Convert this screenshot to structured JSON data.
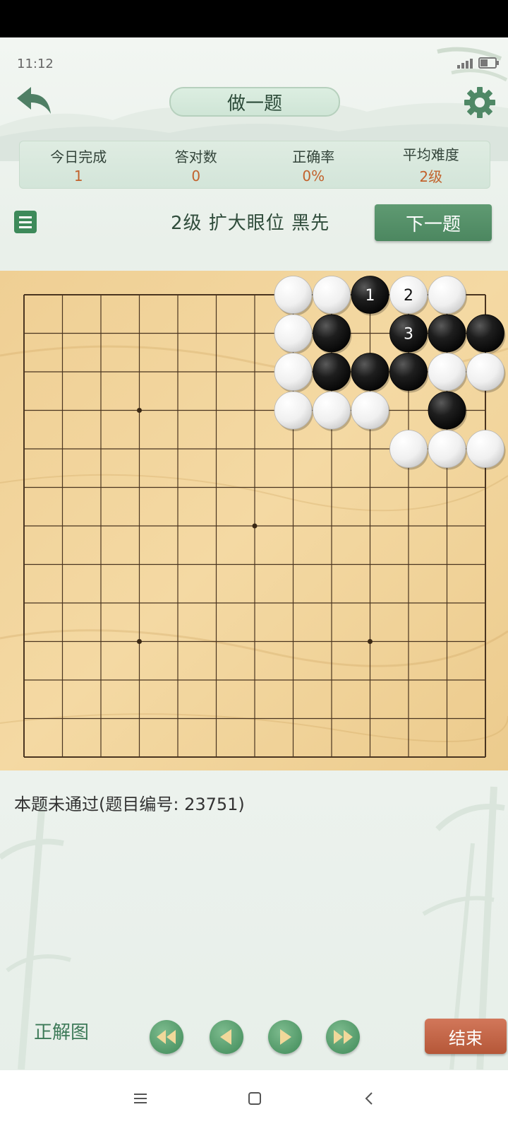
{
  "status_bar": {
    "time": "11:12"
  },
  "header": {
    "title": "做一题",
    "back_icon": "back-arrow-icon",
    "settings_icon": "gear-icon"
  },
  "stats": [
    {
      "label": "今日完成",
      "value": "1"
    },
    {
      "label": "答对数",
      "value": "0"
    },
    {
      "label": "正确率",
      "value": "0%"
    },
    {
      "label": "平均难度",
      "value": "2级"
    }
  ],
  "problem": {
    "title": "2级 扩大眼位 黑先",
    "next_label": "下一题",
    "menu_icon": "list-menu-icon"
  },
  "board": {
    "size": 13,
    "star_points": [
      [
        3,
        3
      ],
      [
        9,
        3
      ],
      [
        6,
        6
      ],
      [
        3,
        9
      ],
      [
        9,
        9
      ]
    ],
    "stones": [
      {
        "col": 7,
        "row": 0,
        "color": "white"
      },
      {
        "col": 8,
        "row": 0,
        "color": "white"
      },
      {
        "col": 9,
        "row": 0,
        "color": "black",
        "label": "1"
      },
      {
        "col": 10,
        "row": 0,
        "color": "white",
        "label": "2"
      },
      {
        "col": 11,
        "row": 0,
        "color": "white"
      },
      {
        "col": 7,
        "row": 1,
        "color": "white"
      },
      {
        "col": 8,
        "row": 1,
        "color": "black"
      },
      {
        "col": 10,
        "row": 1,
        "color": "black",
        "label": "3"
      },
      {
        "col": 11,
        "row": 1,
        "color": "black"
      },
      {
        "col": 12,
        "row": 1,
        "color": "black"
      },
      {
        "col": 7,
        "row": 2,
        "color": "white"
      },
      {
        "col": 8,
        "row": 2,
        "color": "black"
      },
      {
        "col": 9,
        "row": 2,
        "color": "black"
      },
      {
        "col": 10,
        "row": 2,
        "color": "black"
      },
      {
        "col": 11,
        "row": 2,
        "color": "white"
      },
      {
        "col": 12,
        "row": 2,
        "color": "white"
      },
      {
        "col": 7,
        "row": 3,
        "color": "white"
      },
      {
        "col": 8,
        "row": 3,
        "color": "white"
      },
      {
        "col": 9,
        "row": 3,
        "color": "white"
      },
      {
        "col": 11,
        "row": 3,
        "color": "black"
      },
      {
        "col": 10,
        "row": 4,
        "color": "white"
      },
      {
        "col": 11,
        "row": 4,
        "color": "white"
      },
      {
        "col": 12,
        "row": 4,
        "color": "white"
      }
    ]
  },
  "result": {
    "text": "本题未通过(题目编号: 23751)"
  },
  "footer": {
    "answer_label": "正解图",
    "nav_buttons": [
      "fast-backward-icon",
      "step-backward-icon",
      "step-forward-icon",
      "fast-forward-icon"
    ],
    "end_label": "结束"
  },
  "system_nav": {
    "icons": [
      "menu-lines-icon",
      "home-square-icon",
      "back-chevron-icon"
    ]
  }
}
